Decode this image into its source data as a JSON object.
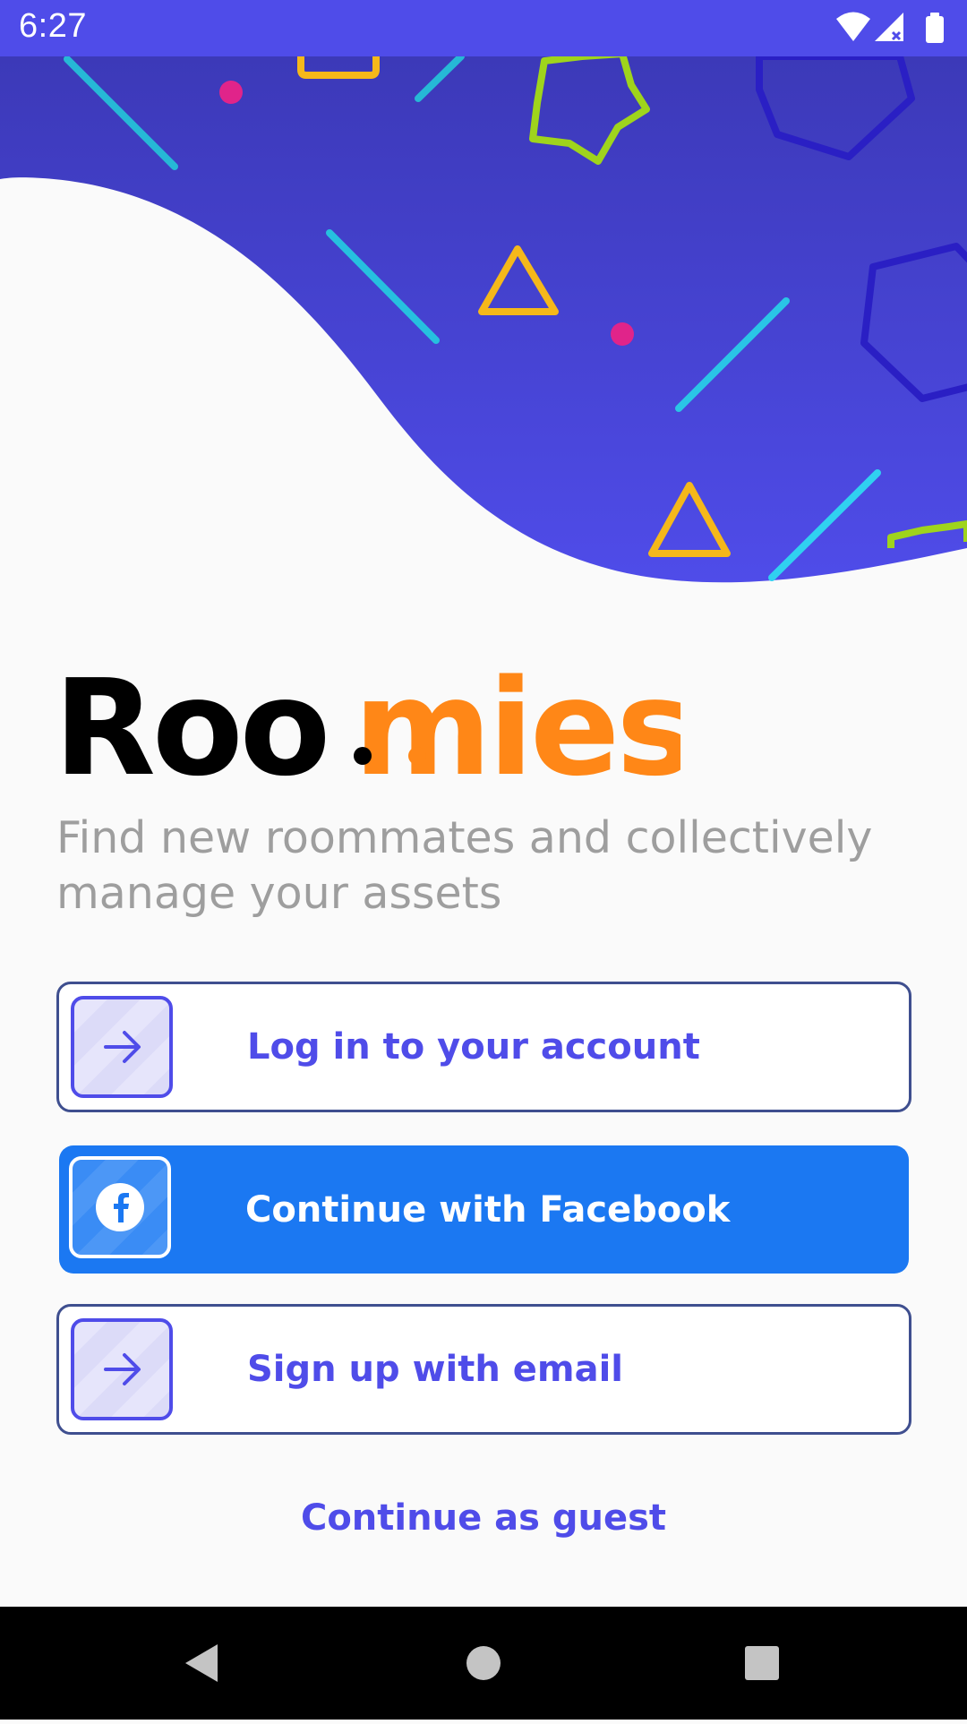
{
  "status_bar": {
    "time": "6:27",
    "background_color": "#4f4ce9",
    "icons": [
      "wifi-icon",
      "cellular-signal-icon",
      "battery-icon"
    ]
  },
  "hero": {
    "background_color": "#4f4ce9",
    "decorations": [
      "line-shape",
      "triangle-shape",
      "star-shape",
      "hexagon-shape",
      "dot-shape"
    ]
  },
  "logo": {
    "part1": "Roo",
    "part2": "mies",
    "part1_color": "#000000",
    "part2_color": "#ff8717"
  },
  "tagline": "Find new roommates and collectively manage your assets",
  "buttons": {
    "login": {
      "label": "Log in to your account",
      "icon": "arrow-right-icon"
    },
    "facebook": {
      "label": "Continue with Facebook",
      "icon": "facebook-icon",
      "color": "#1b78f2"
    },
    "signup": {
      "label": "Sign up with email",
      "icon": "arrow-right-icon"
    }
  },
  "guest_link": "Continue as guest",
  "nav_bar": {
    "buttons": [
      "back-icon",
      "home-icon",
      "recents-icon"
    ]
  },
  "colors": {
    "accent": "#4f4ce9",
    "brand_orange": "#ff8717",
    "tagline_gray": "#9e9e9e"
  }
}
